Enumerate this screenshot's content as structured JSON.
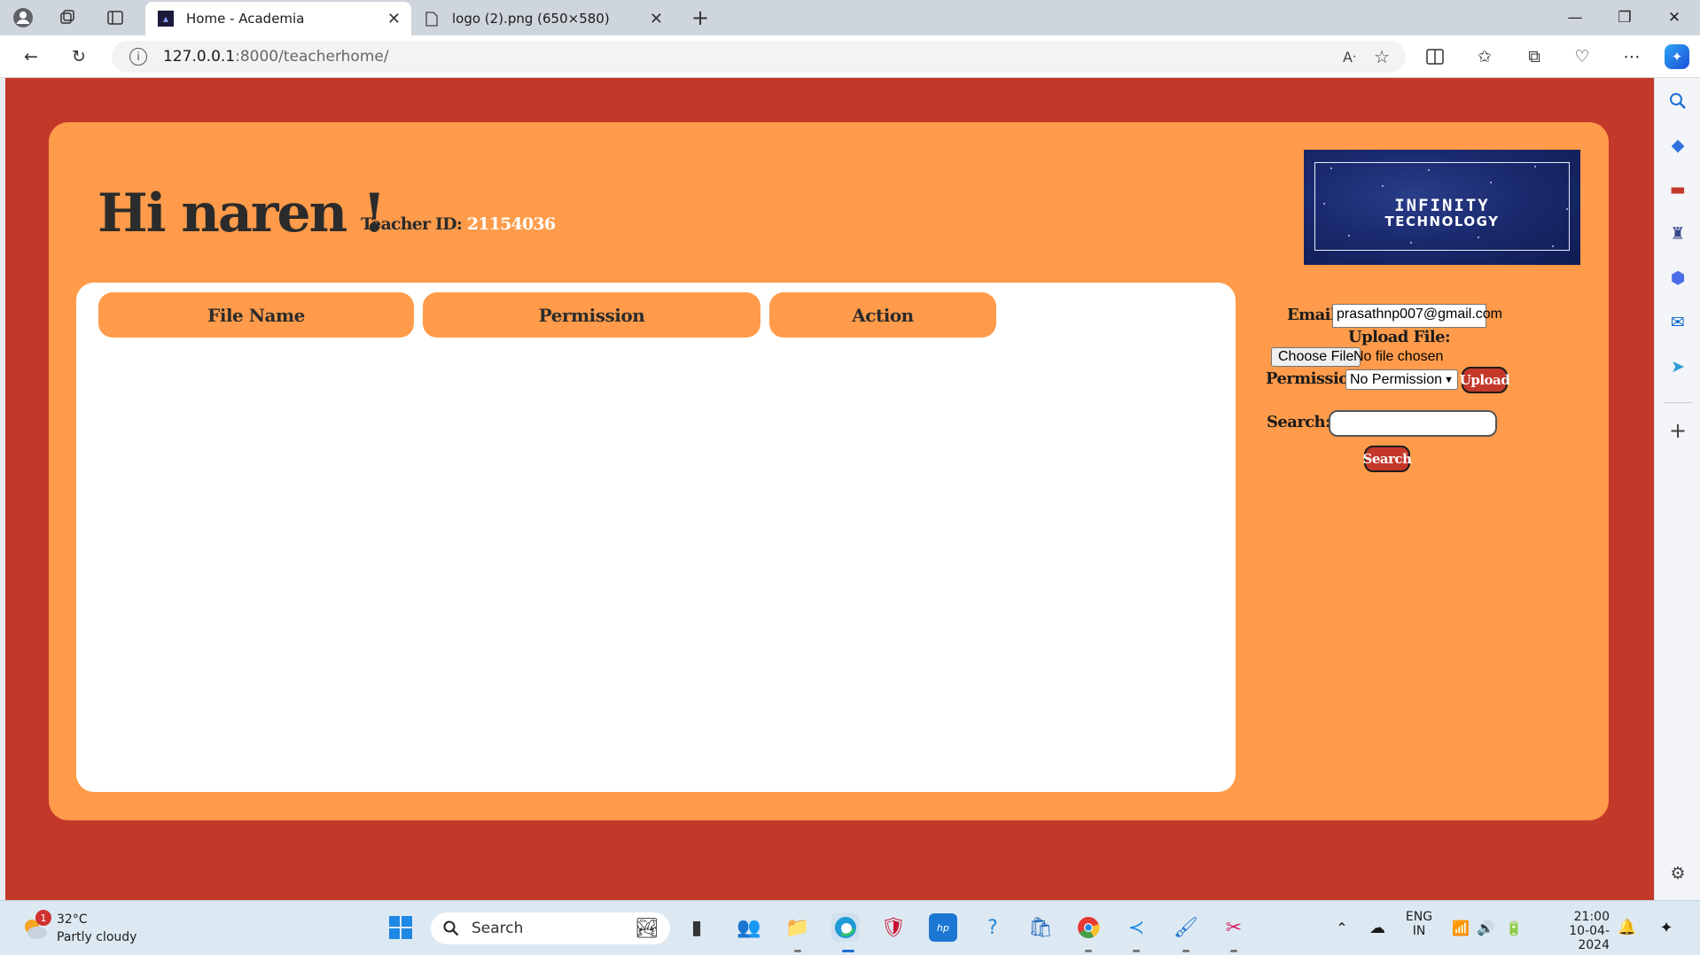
{
  "browser": {
    "tabs": [
      {
        "title": "Home - Academia",
        "active": true
      },
      {
        "title": "logo (2).png (650×580)",
        "active": false
      }
    ],
    "url_host": "127.0.0.1",
    "url_path": ":8000/teacherhome/",
    "window_controls": [
      "minimize",
      "restore",
      "close"
    ]
  },
  "page": {
    "greeting": "Hi naren !",
    "teacher_id_label": "Teacher ID:",
    "teacher_id_value": "21154036",
    "logo": {
      "line1": "INFINITY",
      "line2": "TECHNOLOGY"
    },
    "table": {
      "headers": [
        "File Name",
        "Permission",
        "Action"
      ],
      "rows": []
    },
    "form": {
      "email_label": "Email:",
      "email_value": "prasathnp007@gmail.com",
      "upload_label": "Upload File:",
      "choose_file_button": "Choose File",
      "no_file_text": "No file chosen",
      "permission_label": "Permission:",
      "permission_selected": "No Permission",
      "upload_button": "Upload",
      "search_label": "Search:",
      "search_value": "",
      "search_button": "Search"
    },
    "colors": {
      "page_bg": "#c4382a",
      "card_bg": "#ff9b4a",
      "panel_bg": "#ffffff",
      "button_bg": "#c4382a"
    }
  },
  "taskbar": {
    "weather_temp": "32°C",
    "weather_desc": "Partly cloudy",
    "weather_badge": "1",
    "search_placeholder": "Search",
    "language_line1": "ENG",
    "language_line2": "IN",
    "time": "21:00",
    "date": "10-04-2024"
  }
}
